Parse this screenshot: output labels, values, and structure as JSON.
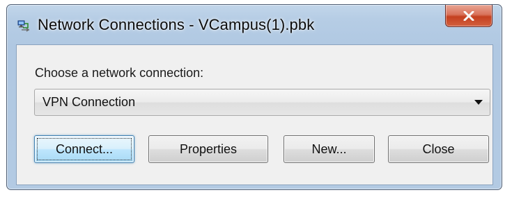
{
  "window": {
    "title": "Network Connections - VCampus(1).pbk",
    "app_icon": "network-connections-icon",
    "close_icon": "close-icon"
  },
  "dialog": {
    "prompt_label": "Choose a network connection:",
    "connection_select": {
      "selected_value": "VPN Connection",
      "icon": "chevron-down-icon"
    },
    "buttons": {
      "connect_label": "Connect...",
      "properties_label": "Properties",
      "new_label": "New...",
      "close_label": "Close"
    }
  },
  "colors": {
    "title_close_red": "#c4401f",
    "default_button_border": "#3c7fb1",
    "client_background": "#f0f0f0"
  }
}
